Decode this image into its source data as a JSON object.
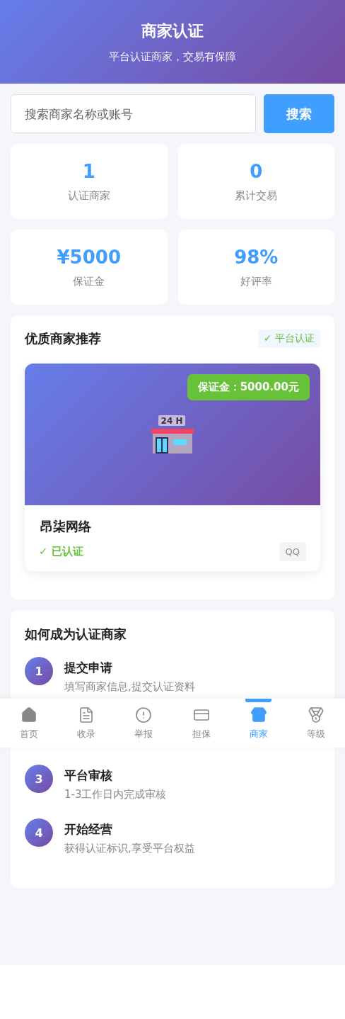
{
  "header": {
    "title": "商家认证",
    "subtitle": "平台认证商家，交易有保障"
  },
  "search": {
    "placeholder": "搜索商家名称或账号",
    "button": "搜索"
  },
  "stats": [
    {
      "value": "1",
      "label": "认证商家"
    },
    {
      "value": "0",
      "label": "累计交易"
    },
    {
      "value": "¥5000",
      "label": "保证金"
    },
    {
      "value": "98%",
      "label": "好评率"
    }
  ],
  "featured": {
    "title": "优质商家推荐",
    "badge": "✓ 平台认证",
    "merchant": {
      "deposit": "保证金：5000.00元",
      "sign_text": "24 H",
      "name": "昂柒网络",
      "verified": true,
      "verified_label": "✓ 已认证",
      "contact": "QQ"
    }
  },
  "steps": {
    "title": "如何成为认证商家",
    "items": [
      {
        "number": "1",
        "title": "提交申请",
        "description": "填写商家信息,提交认证资料"
      },
      {
        "number": "3",
        "title": "平台审核",
        "description": "1-3工作日内完成审核"
      },
      {
        "number": "4",
        "title": "开始经营",
        "description": "获得认证标识,享受平台权益"
      }
    ]
  },
  "nav": [
    {
      "kind": "home",
      "label": "首页",
      "selected": false
    },
    {
      "kind": "file",
      "label": "收录",
      "selected": false
    },
    {
      "kind": "alert",
      "label": "举报",
      "selected": false
    },
    {
      "kind": "card",
      "label": "担保",
      "selected": false
    },
    {
      "kind": "store",
      "label": "商家",
      "selected": true
    },
    {
      "kind": "medal",
      "label": "等级",
      "selected": false
    }
  ]
}
